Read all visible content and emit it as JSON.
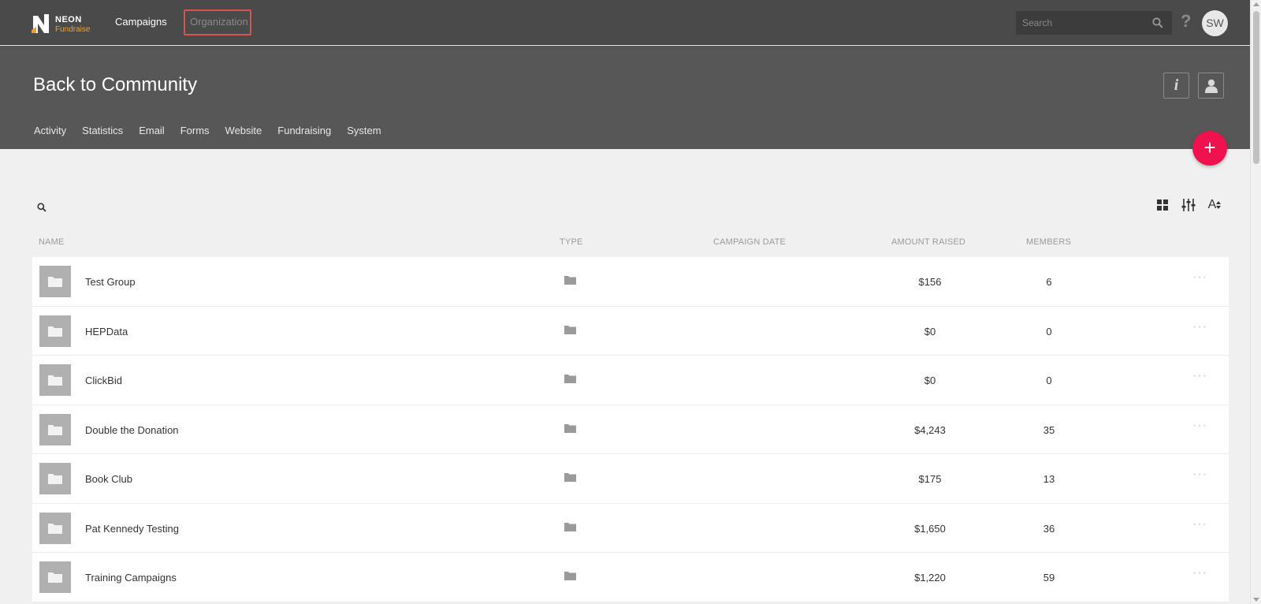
{
  "app": {
    "logo_top": "NEON",
    "logo_bottom": "Fundraise"
  },
  "topnav": {
    "campaigns": "Campaigns",
    "organization": "Organization",
    "search_placeholder": "Search",
    "help": "?",
    "avatar_initials": "SW"
  },
  "header": {
    "title": "Back to Community",
    "tabs": [
      "Activity",
      "Statistics",
      "Email",
      "Forms",
      "Website",
      "Fundraising",
      "System"
    ],
    "add_button": "+"
  },
  "toolbar": {
    "sort_label": "A"
  },
  "table": {
    "columns": {
      "name": "NAME",
      "type": "TYPE",
      "campaign_date": "CAMPAIGN DATE",
      "amount_raised": "AMOUNT RAISED",
      "members": "MEMBERS"
    },
    "rows": [
      {
        "name": "Test Group",
        "amount": "$156",
        "members": "6"
      },
      {
        "name": "HEPData",
        "amount": "$0",
        "members": "0"
      },
      {
        "name": "ClickBid",
        "amount": "$0",
        "members": "0"
      },
      {
        "name": "Double the Donation",
        "amount": "$4,243",
        "members": "35"
      },
      {
        "name": "Book Club",
        "amount": "$175",
        "members": "13"
      },
      {
        "name": "Pat Kennedy Testing",
        "amount": "$1,650",
        "members": "36"
      },
      {
        "name": "Training Campaigns",
        "amount": "$1,220",
        "members": "59"
      }
    ],
    "more_label": "···"
  },
  "colors": {
    "topbar": "#4a4a4a",
    "header": "#575757",
    "accent": "#f0124e",
    "highlight_box": "#d9534f",
    "logo_orange": "#f0a030"
  },
  "icons": {
    "row_thumb": "folder-icon",
    "row_type": "folder-icon",
    "more": "ellipsis-icon",
    "info": "info-icon",
    "user": "user-icon",
    "grid": "grid-view-icon",
    "filter": "filter-sliders-icon",
    "sort": "sort-alpha-icon"
  }
}
